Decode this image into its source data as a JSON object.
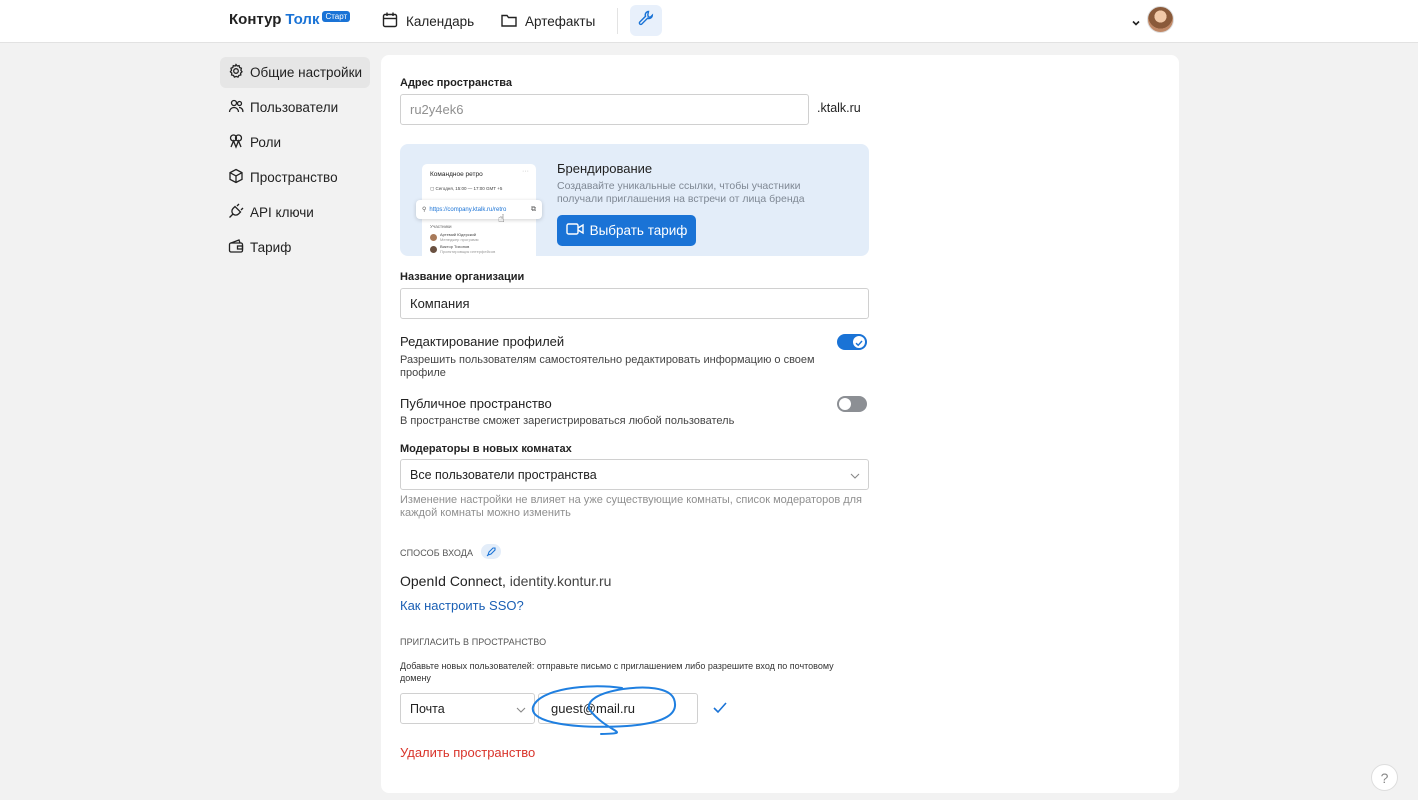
{
  "header": {
    "logo_main": "Контур",
    "logo_accent": "Толк",
    "logo_badge": "Старт",
    "nav": [
      {
        "label": "Календарь",
        "icon": "calendar-icon"
      },
      {
        "label": "Артефакты",
        "icon": "folder-icon"
      }
    ],
    "tools_icon": "wrench-icon",
    "accent_color": "#1a73d6"
  },
  "sidebar": {
    "items": [
      {
        "label": "Общие настройки",
        "icon": "gear-icon",
        "active": true
      },
      {
        "label": "Пользователи",
        "icon": "users-icon",
        "active": false
      },
      {
        "label": "Роли",
        "icon": "roles-icon",
        "active": false
      },
      {
        "label": "Пространство",
        "icon": "cube-icon",
        "active": false
      },
      {
        "label": "API ключи",
        "icon": "plug-icon",
        "active": false
      },
      {
        "label": "Тариф",
        "icon": "wallet-icon",
        "active": false
      }
    ]
  },
  "address": {
    "label": "Адрес пространства",
    "value": "ru2y4ek6",
    "suffix": ".ktalk.ru"
  },
  "promo": {
    "title": "Брендирование",
    "text_line1": "Создавайте уникальные ссылки, чтобы участники",
    "text_line2": "получали приглашения на встречи от лица бренда",
    "button": "Выбрать тариф",
    "mock_title": "Командное ретро",
    "mock_time": "Сегодня, 15:00 — 17:00 GMT +5",
    "mock_link": "https://company.ktalk.ru/retro",
    "mock_participants": "Участники",
    "mock_person1": "Артемий Юдерский",
    "mock_person1_role": "Менеджер программ",
    "mock_person2": "Виктор Тихонов",
    "mock_person2_role": "Проектировщик интерфейсов"
  },
  "org": {
    "label": "Название организации",
    "value": "Компания"
  },
  "profile_edit": {
    "title": "Редактирование профилей",
    "desc_line1": "Разрешить пользователям самостоятельно редактировать информацию о своем",
    "desc_line2": "профиле",
    "enabled": true
  },
  "public_space": {
    "title": "Публичное пространство",
    "desc": "В пространстве сможет зарегистрироваться любой пользователь",
    "enabled": false
  },
  "moderators": {
    "label": "Модераторы в новых комнатах",
    "selected": "Все пользователи пространства",
    "hint_line1": "Изменение настройки не влияет на уже существующие комнаты, список модераторов для",
    "hint_line2": "каждой комнаты можно изменить"
  },
  "login": {
    "caption": "СПОСОБ ВХОДА",
    "method": "OpenId Connect,",
    "provider": "identity.kontur.ru",
    "link": "Как настроить SSO?"
  },
  "invite": {
    "caption": "ПРИГЛАСИТЬ В ПРОСТРАНСТВО",
    "desc_line1": "Добавьте новых пользователей: отправьте письмо с приглашением либо разрешите вход по почтовому",
    "desc_line2": "домену",
    "type_selected": "Почта",
    "email_value": "guest@mail.ru"
  },
  "delete_label": "Удалить пространство",
  "help_label": "?"
}
